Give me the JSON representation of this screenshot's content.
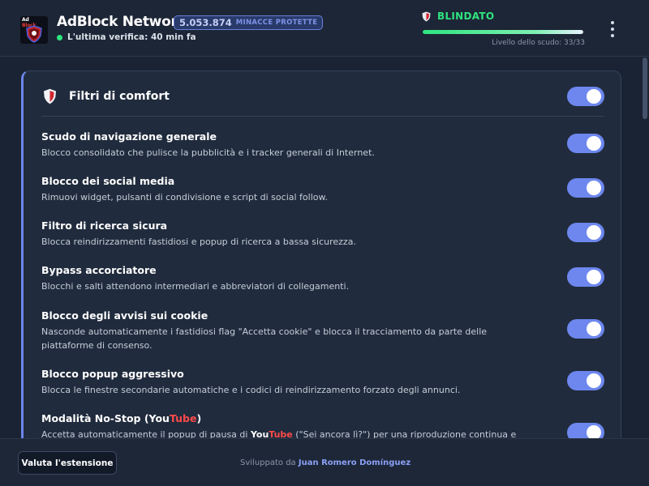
{
  "header": {
    "logo_text_top": "Ad",
    "logo_text_bottom": "Block",
    "title": "AdBlock Network",
    "threat_count": "5.053.874",
    "threat_label": "MINACCE PROTETTE",
    "last_check": "L'ultima verifica: 40 min fa",
    "shield_status": "BLINDATO",
    "shield_progress": 1.0,
    "shield_level": "Livello dello scudo: 33/33",
    "menu_icon": "kebab-menu-icon",
    "status_color": "#2ee57f"
  },
  "card": {
    "title": "Filtri di comfort",
    "icon": "shield-icon",
    "accent_color": "#6c86e9",
    "master_toggle_on": true
  },
  "filters": [
    {
      "title": "Scudo di navigazione generale",
      "desc": "Blocco consolidato che pulisce la pubblicità e i tracker generali di Internet.",
      "on": true
    },
    {
      "title": "Blocco dei social media",
      "desc": "Rimuovi widget, pulsanti di condivisione e script di social follow.",
      "on": true
    },
    {
      "title": "Filtro di ricerca sicura",
      "desc": "Blocca reindirizzamenti fastidiosi e popup di ricerca a bassa sicurezza.",
      "on": true
    },
    {
      "title": "Bypass accorciatore",
      "desc": "Blocchi e salti attendono intermediari e abbreviatori di collegamenti.",
      "on": true
    },
    {
      "title": "Blocco degli avvisi sui cookie",
      "desc": "Nasconde automaticamente i fastidiosi flag \"Accetta cookie\" e blocca il tracciamento da parte delle piattaforme di consenso.",
      "on": true
    },
    {
      "title": "Blocco popup aggressivo",
      "desc": "Blocca le finestre secondarie automatiche e i codici di reindirizzamento forzato degli annunci.",
      "on": true
    },
    {
      "title_prefix": "Modalità No-Stop (You",
      "title_highlight": "Tube",
      "title_suffix": ")",
      "desc_prefix": "Accetta automaticamente il popup di pausa di ",
      "desc_brand_you": "You",
      "desc_brand_tube": "Tube",
      "desc_suffix": " (\"Sei ancora lì?\") per una riproduzione continua e",
      "on": true
    }
  ],
  "footer": {
    "rate_button": "Valuta l'estensione",
    "credits_prefix": "Sviluppato da",
    "credits_author": "Juan Romero Domínguez"
  }
}
